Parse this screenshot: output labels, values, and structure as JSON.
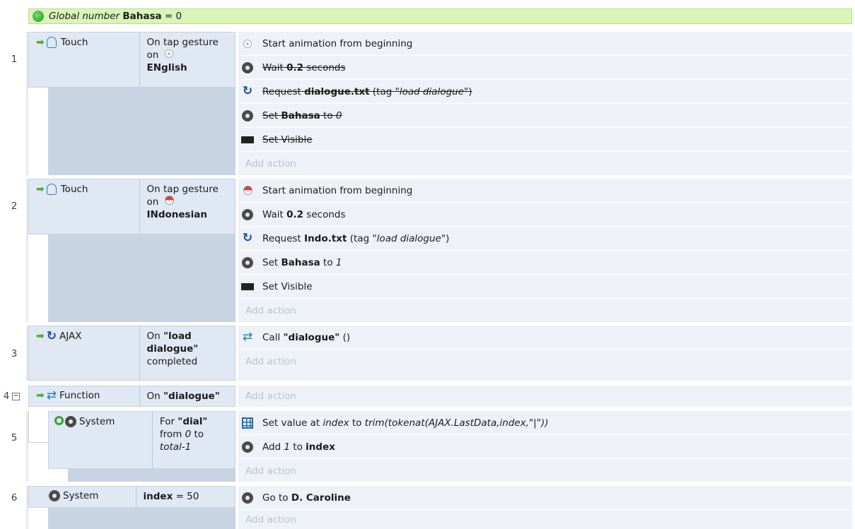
{
  "global": {
    "label": "Global number",
    "name": "Bahasa",
    "value": "= 0"
  },
  "events": [
    {
      "num": "1",
      "object": "Touch",
      "cond_pre": "On tap gesture on",
      "cond_bold": "ENglish",
      "actions": [
        {
          "icon": "english-sprite-icon",
          "text": "Start animation from beginning",
          "disabled": false
        },
        {
          "icon": "system-gear-icon",
          "pre": "Wait ",
          "bold": "0.2",
          "post": " seconds",
          "disabled": true
        },
        {
          "icon": "ajax-icon",
          "pre": "Request ",
          "bold": "dialogue.txt",
          "post": " (tag ",
          "ital": "\"load dialogue\"",
          "end": ")",
          "disabled": true
        },
        {
          "icon": "system-gear-icon",
          "pre": "Set ",
          "bold": "Bahasa",
          "post": " to ",
          "ital": "0",
          "disabled": true
        },
        {
          "icon": "black-rectangle-icon",
          "text": "Set Visible",
          "disabled": true
        }
      ],
      "add_action": "Add action"
    },
    {
      "num": "2",
      "object": "Touch",
      "cond_pre": "On tap gesture on",
      "cond_bold": "INdonesian",
      "actions": [
        {
          "icon": "indonesia-flag-icon",
          "text": "Start animation from beginning"
        },
        {
          "icon": "system-gear-icon",
          "pre": "Wait ",
          "bold": "0.2",
          "post": " seconds"
        },
        {
          "icon": "ajax-icon",
          "pre": "Request ",
          "bold": "Indo.txt",
          "post": " (tag ",
          "ital": "\"load dialogue\"",
          "end": ")"
        },
        {
          "icon": "system-gear-icon",
          "pre": "Set ",
          "bold": "Bahasa",
          "post": " to ",
          "ital": "1"
        },
        {
          "icon": "black-rectangle-icon",
          "text": "Set Visible"
        }
      ],
      "add_action": "Add action"
    },
    {
      "num": "3",
      "object": "AJAX",
      "cond_pre": "On",
      "cond_bold": "\"load dialogue\"",
      "cond_post": "completed",
      "actions": [
        {
          "icon": "function-icon",
          "pre": "Call ",
          "bold": "\"dialogue\"",
          "post": " ()"
        }
      ],
      "add_action": "Add action"
    },
    {
      "num": "4",
      "object": "Function",
      "cond_pre": "On",
      "cond_bold": "\"dialogue\"",
      "add_action": "Add action"
    },
    {
      "num": "5",
      "object": "System",
      "cond_pre": "For",
      "cond_bold": "\"dial\"",
      "cond_mid": "from",
      "cond_ital1": "0",
      "cond_to": "to",
      "cond_ital2": "total-1",
      "actions": [
        {
          "icon": "array-grid-icon",
          "pre": "Set value at ",
          "ital": "index",
          "post": " to ",
          "ital2": "trim(tokenat(AJAX.LastData,index,\"|\"))"
        },
        {
          "icon": "system-gear-icon",
          "pre": "Add ",
          "ital": "1",
          "post": " to ",
          "bold": "index"
        }
      ],
      "add_action": "Add action"
    },
    {
      "num": "6",
      "object": "System",
      "cond_bold": "index",
      "cond_post": "= 50",
      "actions": [
        {
          "icon": "system-gear-icon",
          "pre": "Go to ",
          "bold": "D. Caroline"
        }
      ],
      "add_action": "Add action"
    }
  ]
}
